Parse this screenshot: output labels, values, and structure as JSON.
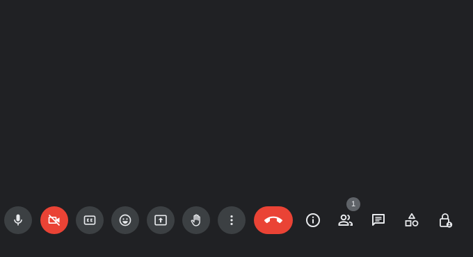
{
  "toolbar": {
    "buttons": [
      {
        "icon": "microphone-icon"
      },
      {
        "icon": "camera-off-icon",
        "state": "off",
        "color": "#ea4335"
      },
      {
        "icon": "closed-captions-icon"
      },
      {
        "icon": "emoji-reaction-icon"
      },
      {
        "icon": "present-screen-icon"
      },
      {
        "icon": "raise-hand-icon"
      },
      {
        "icon": "more-options-icon"
      },
      {
        "icon": "hang-up-icon",
        "color": "#ea4335"
      }
    ],
    "side_panel": [
      {
        "icon": "info-icon"
      },
      {
        "icon": "people-icon"
      },
      {
        "icon": "chat-icon"
      },
      {
        "icon": "activities-icon"
      },
      {
        "icon": "host-controls-icon"
      }
    ],
    "participant_count": "1"
  },
  "colors": {
    "background": "#202124",
    "button": "#3c4043",
    "danger": "#ea4335",
    "icon": "#e8eaed",
    "badge": "#5f6368"
  }
}
